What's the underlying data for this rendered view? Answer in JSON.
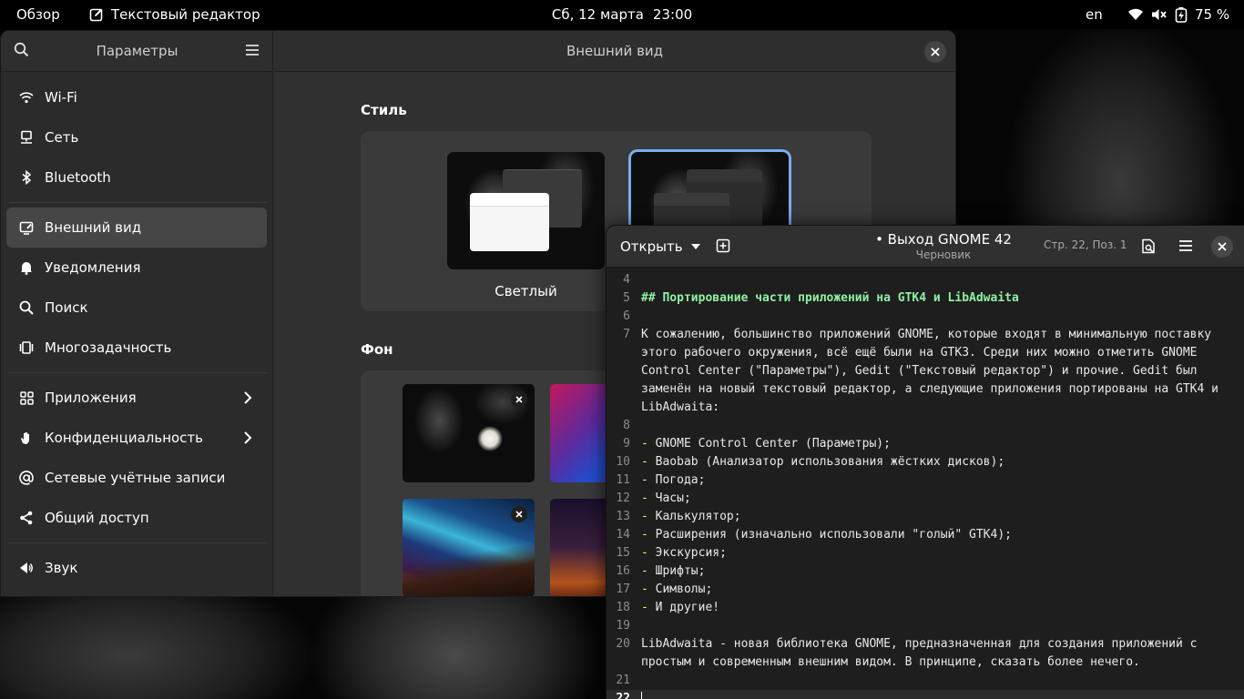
{
  "topbar": {
    "overview": "Обзор",
    "app_name": "Текстовый редактор",
    "date": "Сб, 12 марта",
    "time": "23:00",
    "language": "en",
    "battery": "75 %"
  },
  "settings": {
    "sidebar_title": "Параметры",
    "page_title": "Внешний вид",
    "sidebar_items": [
      {
        "label": "Wi-Fi",
        "icon": "wifi-icon"
      },
      {
        "label": "Сеть",
        "icon": "network-icon"
      },
      {
        "label": "Bluetooth",
        "icon": "bluetooth-icon"
      },
      {
        "label": "Внешний вид",
        "icon": "appearance-icon",
        "active": true
      },
      {
        "label": "Уведомления",
        "icon": "bell-icon"
      },
      {
        "label": "Поиск",
        "icon": "search-icon"
      },
      {
        "label": "Многозадачность",
        "icon": "multitasking-icon"
      },
      {
        "label": "Приложения",
        "icon": "apps-icon",
        "has_submenu": true
      },
      {
        "label": "Конфиденциальность",
        "icon": "hand-icon",
        "has_submenu": true
      },
      {
        "label": "Сетевые учётные записи",
        "icon": "at-icon"
      },
      {
        "label": "Общий доступ",
        "icon": "share-icon"
      },
      {
        "label": "Звук",
        "icon": "sound-icon"
      }
    ],
    "style_section": "Стиль",
    "style_light_label": "Светлый",
    "background_section": "Фон"
  },
  "editor": {
    "open_label": "Открыть",
    "title": "• Выход GNOME 42",
    "subtitle": "Черновик",
    "position": "Стр. 22, Поз.  1",
    "lines": [
      {
        "n": "4",
        "text": ""
      },
      {
        "n": "5",
        "text": "## Портирование части приложений на GTK4 и LibAdwaita",
        "kind": "heading"
      },
      {
        "n": "6",
        "text": ""
      },
      {
        "n": "7",
        "text": "К сожалению, большинство приложений GNOME, которые входят в минимальную поставку"
      },
      {
        "n": "",
        "text": "этого рабочего окружения, всё ещё были на GTK3. Среди них можно отметить GNOME"
      },
      {
        "n": "",
        "text": "Control Center (\"Параметры\"), Gedit (\"Текстовый редактор\") и прочие. Gedit был"
      },
      {
        "n": "",
        "text": "заменён на новый текстовый редактор, а следующие приложения портированы на GTK4 и"
      },
      {
        "n": "",
        "text": "LibAdwaita:"
      },
      {
        "n": "8",
        "text": ""
      },
      {
        "n": "9",
        "bullet": "-",
        "text": " GNOME Control Center (Параметры);"
      },
      {
        "n": "10",
        "bullet": "-",
        "text": " Baobab (Анализатор использования жёстких дисков);"
      },
      {
        "n": "11",
        "bullet": "-",
        "text": " Погода;"
      },
      {
        "n": "12",
        "bullet": "-",
        "text": " Часы;"
      },
      {
        "n": "13",
        "bullet": "-",
        "text": " Калькулятор;"
      },
      {
        "n": "14",
        "bullet": "-",
        "text": " Расширения (изначально использовали \"голый\" GTK4);"
      },
      {
        "n": "15",
        "bullet": "-",
        "text": " Экскурсия;"
      },
      {
        "n": "16",
        "bullet": "-",
        "text": " Шрифты;"
      },
      {
        "n": "17",
        "bullet": "-",
        "text": " Символы;"
      },
      {
        "n": "18",
        "bullet": "-",
        "text": " И другие!"
      },
      {
        "n": "19",
        "text": ""
      },
      {
        "n": "20",
        "text": "LibAdwaita - новая библиотека GNOME, предназначенная для создания приложений с"
      },
      {
        "n": "",
        "text": "простым и современным внешним видом. В принципе, сказать более нечего."
      },
      {
        "n": "21",
        "text": ""
      },
      {
        "n": "22",
        "text": "",
        "current": true
      }
    ]
  }
}
